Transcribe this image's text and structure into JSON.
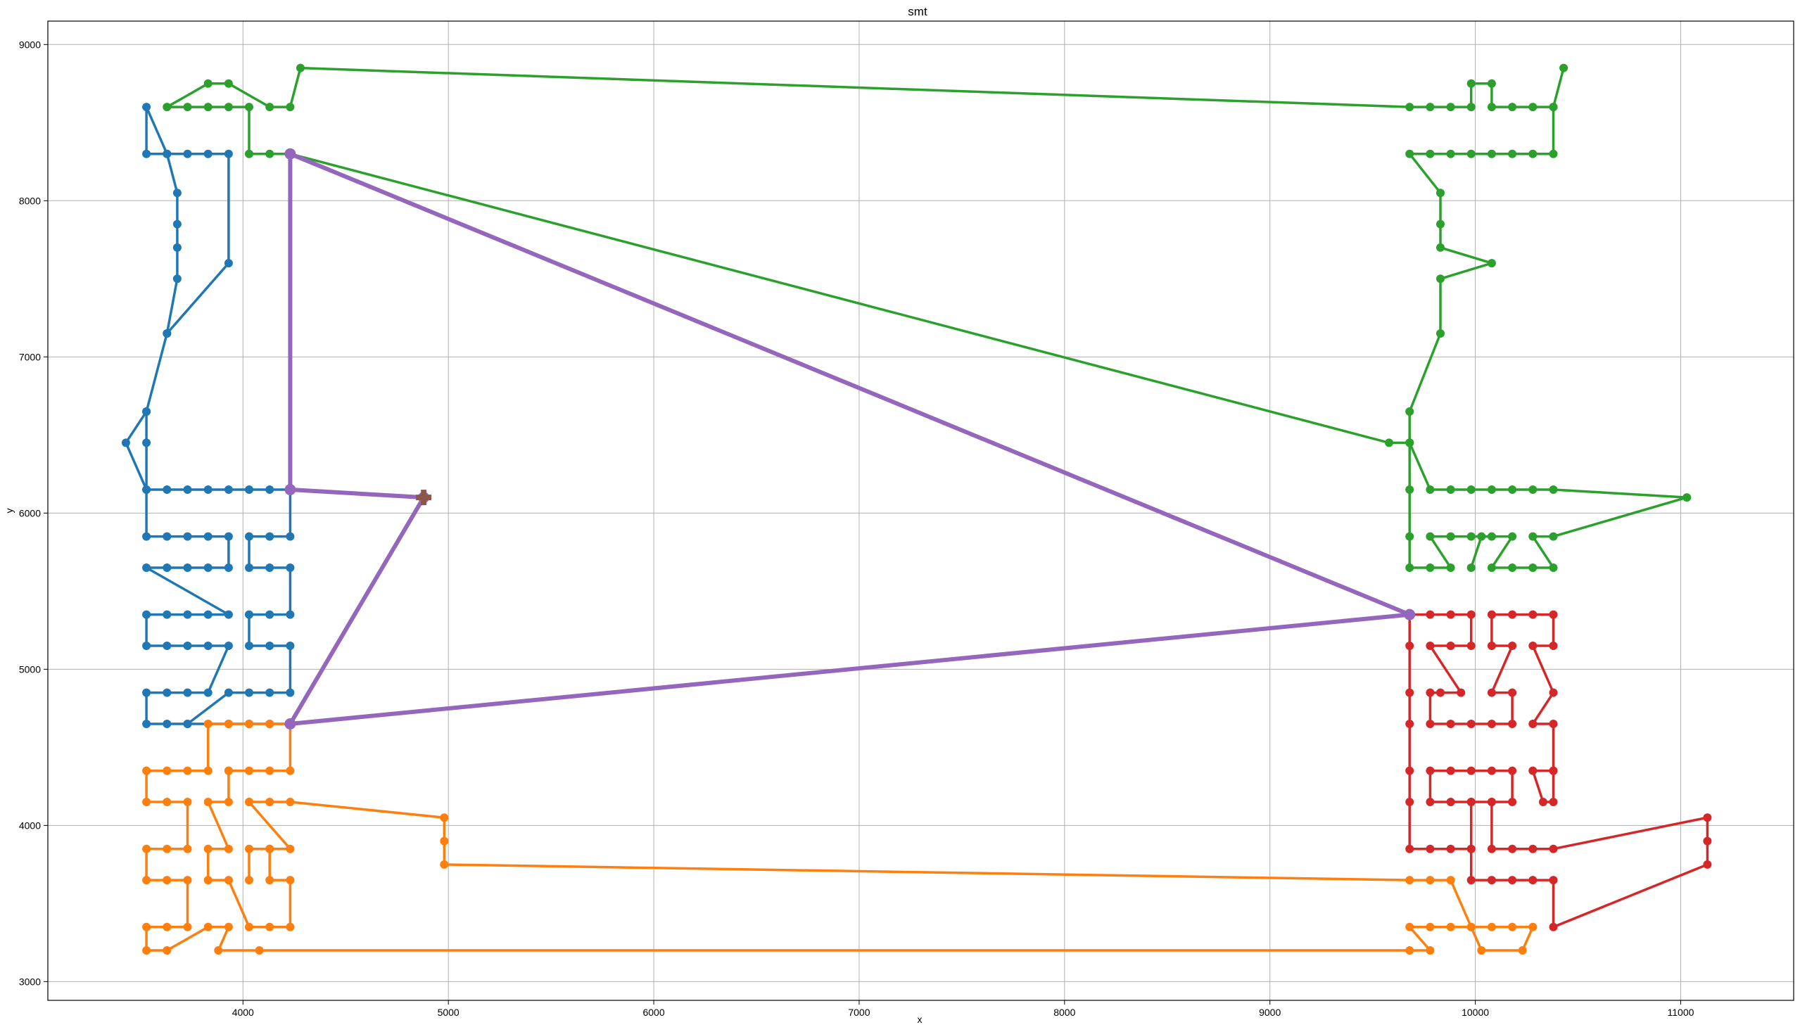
{
  "chart_data": {
    "type": "line",
    "title": "smt",
    "xlabel": "x",
    "ylabel": "y",
    "xlim": [
      3050,
      11550
    ],
    "ylim": [
      2880,
      9150
    ],
    "xticks": [
      4000,
      5000,
      6000,
      7000,
      8000,
      9000,
      10000,
      11000
    ],
    "yticks": [
      3000,
      4000,
      5000,
      6000,
      7000,
      8000,
      9000
    ],
    "grid": true,
    "colors": {
      "blue": "#1f77b4",
      "orange": "#ff7f0e",
      "green": "#2ca02c",
      "red": "#d62728",
      "purple": "#9467bd",
      "brown": "#8c564b"
    },
    "series": [
      {
        "color": "#1f77b4",
        "points": [
          [
            4230,
            4650
          ],
          [
            4130,
            4650
          ],
          [
            4030,
            4650
          ],
          [
            3930,
            4650
          ],
          [
            3730,
            4650
          ],
          [
            3630,
            4650
          ],
          [
            3530,
            4650
          ],
          [
            3530,
            4850
          ],
          [
            3630,
            4850
          ],
          [
            3730,
            4850
          ],
          [
            3830,
            4850
          ],
          [
            3930,
            5150
          ],
          [
            3830,
            5150
          ],
          [
            3730,
            5150
          ],
          [
            3630,
            5150
          ],
          [
            3530,
            5150
          ],
          [
            3530,
            5350
          ],
          [
            3630,
            5350
          ],
          [
            3730,
            5350
          ],
          [
            3830,
            5350
          ],
          [
            3930,
            5350
          ],
          [
            3530,
            5650
          ],
          [
            3630,
            5650
          ],
          [
            3730,
            5650
          ],
          [
            3830,
            5650
          ],
          [
            3930,
            5650
          ],
          [
            3930,
            5850
          ],
          [
            3830,
            5850
          ],
          [
            3730,
            5850
          ],
          [
            3630,
            5850
          ],
          [
            3530,
            5850
          ],
          [
            3530,
            6150
          ],
          [
            3530,
            6450
          ],
          [
            3530,
            6650
          ],
          [
            3430,
            6450
          ],
          [
            3530,
            6150
          ],
          [
            3630,
            6150
          ],
          [
            3730,
            6150
          ],
          [
            3830,
            6150
          ],
          [
            3930,
            6150
          ],
          [
            4030,
            6150
          ],
          [
            4130,
            6150
          ],
          [
            4230,
            6150
          ],
          [
            4230,
            5850
          ],
          [
            4130,
            5850
          ],
          [
            4030,
            5850
          ],
          [
            4030,
            5650
          ],
          [
            4130,
            5650
          ],
          [
            4230,
            5650
          ],
          [
            4230,
            5350
          ],
          [
            4130,
            5350
          ],
          [
            4030,
            5350
          ],
          [
            4030,
            5150
          ],
          [
            4130,
            5150
          ],
          [
            4230,
            5150
          ],
          [
            4230,
            4850
          ],
          [
            4130,
            4850
          ],
          [
            4030,
            4850
          ],
          [
            3930,
            4850
          ],
          [
            3730,
            4650
          ]
        ]
      },
      {
        "color": "#1f77b4",
        "points": [
          [
            3530,
            6650
          ],
          [
            3630,
            7150
          ],
          [
            3680,
            7500
          ],
          [
            3680,
            7700
          ],
          [
            3680,
            7850
          ],
          [
            3680,
            8050
          ],
          [
            3630,
            8300
          ],
          [
            3530,
            8300
          ],
          [
            3530,
            8600
          ],
          [
            3630,
            8300
          ],
          [
            3730,
            8300
          ],
          [
            3830,
            8300
          ],
          [
            3930,
            8300
          ],
          [
            3930,
            7600
          ],
          [
            3630,
            7150
          ]
        ]
      },
      {
        "color": "#ff7f0e",
        "points": [
          [
            4230,
            4650
          ],
          [
            4130,
            4650
          ],
          [
            4030,
            4650
          ],
          [
            3930,
            4650
          ],
          [
            3830,
            4650
          ],
          [
            3830,
            4350
          ],
          [
            3730,
            4350
          ],
          [
            3630,
            4350
          ],
          [
            3530,
            4350
          ],
          [
            3530,
            4150
          ],
          [
            3630,
            4150
          ],
          [
            3730,
            4150
          ],
          [
            3730,
            3850
          ],
          [
            3630,
            3850
          ],
          [
            3530,
            3850
          ],
          [
            3530,
            3650
          ],
          [
            3630,
            3650
          ],
          [
            3730,
            3650
          ],
          [
            3730,
            3350
          ],
          [
            3630,
            3350
          ],
          [
            3530,
            3350
          ],
          [
            3530,
            3200
          ],
          [
            3630,
            3200
          ],
          [
            3830,
            3350
          ],
          [
            3930,
            3350
          ],
          [
            3880,
            3200
          ],
          [
            4080,
            3200
          ],
          [
            9680,
            3200
          ],
          [
            9780,
            3200
          ],
          [
            9680,
            3350
          ],
          [
            9780,
            3350
          ],
          [
            9880,
            3350
          ],
          [
            9980,
            3350
          ],
          [
            10080,
            3350
          ],
          [
            10180,
            3350
          ],
          [
            10280,
            3350
          ],
          [
            10230,
            3200
          ],
          [
            10030,
            3200
          ],
          [
            9980,
            3350
          ]
        ]
      },
      {
        "color": "#ff7f0e",
        "points": [
          [
            3930,
            4350
          ],
          [
            4030,
            4350
          ],
          [
            4130,
            4350
          ],
          [
            4230,
            4350
          ],
          [
            4230,
            4650
          ]
        ]
      },
      {
        "color": "#ff7f0e",
        "points": [
          [
            3930,
            4350
          ],
          [
            3930,
            4150
          ],
          [
            3830,
            4150
          ],
          [
            3930,
            3850
          ],
          [
            3830,
            3850
          ],
          [
            3830,
            3650
          ],
          [
            3930,
            3650
          ],
          [
            4030,
            3350
          ],
          [
            4130,
            3350
          ],
          [
            4230,
            3350
          ],
          [
            4230,
            3650
          ],
          [
            4130,
            3650
          ],
          [
            4130,
            3850
          ],
          [
            4030,
            3850
          ],
          [
            4030,
            3650
          ]
        ]
      },
      {
        "color": "#ff7f0e",
        "points": [
          [
            4030,
            4150
          ],
          [
            4230,
            3850
          ],
          [
            4130,
            3850
          ]
        ]
      },
      {
        "color": "#ff7f0e",
        "points": [
          [
            4030,
            4150
          ],
          [
            4130,
            4150
          ],
          [
            4230,
            4150
          ],
          [
            4980,
            4050
          ],
          [
            4980,
            3900
          ],
          [
            4980,
            3750
          ],
          [
            9680,
            3650
          ],
          [
            9780,
            3650
          ],
          [
            9880,
            3650
          ],
          [
            9980,
            3350
          ]
        ]
      },
      {
        "color": "#2ca02c",
        "points": [
          [
            4230,
            8300
          ],
          [
            4130,
            8300
          ],
          [
            4030,
            8300
          ],
          [
            4030,
            8600
          ],
          [
            3930,
            8600
          ],
          [
            3830,
            8600
          ],
          [
            3730,
            8600
          ],
          [
            3630,
            8600
          ],
          [
            3830,
            8750
          ],
          [
            3930,
            8750
          ],
          [
            4130,
            8600
          ],
          [
            4230,
            8600
          ],
          [
            4280,
            8850
          ],
          [
            9680,
            8600
          ],
          [
            9780,
            8600
          ],
          [
            9880,
            8600
          ],
          [
            9980,
            8600
          ],
          [
            9980,
            8750
          ],
          [
            10080,
            8750
          ],
          [
            10080,
            8600
          ],
          [
            10180,
            8600
          ],
          [
            10280,
            8600
          ],
          [
            10380,
            8600
          ],
          [
            10430,
            8850
          ],
          [
            10380,
            8600
          ],
          [
            10380,
            8300
          ],
          [
            10280,
            8300
          ],
          [
            10180,
            8300
          ],
          [
            10080,
            8300
          ],
          [
            9980,
            8300
          ],
          [
            9880,
            8300
          ],
          [
            9780,
            8300
          ],
          [
            9680,
            8300
          ],
          [
            9830,
            8050
          ],
          [
            9830,
            7850
          ],
          [
            9830,
            7700
          ],
          [
            10080,
            7600
          ],
          [
            9830,
            7500
          ],
          [
            9830,
            7150
          ],
          [
            9680,
            6650
          ],
          [
            9680,
            6450
          ],
          [
            9580,
            6450
          ],
          [
            4230,
            8300
          ]
        ]
      },
      {
        "color": "#2ca02c",
        "points": [
          [
            9680,
            6450
          ],
          [
            9780,
            6150
          ],
          [
            9880,
            6150
          ],
          [
            9980,
            6150
          ],
          [
            10080,
            6150
          ],
          [
            10180,
            6150
          ],
          [
            10280,
            6150
          ],
          [
            10380,
            6150
          ],
          [
            11030,
            6100
          ],
          [
            10380,
            5850
          ],
          [
            10280,
            5850
          ],
          [
            10380,
            5650
          ],
          [
            10280,
            5650
          ],
          [
            10180,
            5650
          ],
          [
            10080,
            5650
          ],
          [
            10180,
            5850
          ],
          [
            10080,
            5850
          ],
          [
            9980,
            5850
          ],
          [
            9880,
            5850
          ],
          [
            9780,
            5850
          ],
          [
            9880,
            5650
          ],
          [
            9780,
            5650
          ],
          [
            9680,
            5650
          ],
          [
            9680,
            5850
          ],
          [
            9680,
            6150
          ],
          [
            9680,
            6450
          ]
        ]
      },
      {
        "color": "#2ca02c",
        "points": [
          [
            9980,
            5650
          ],
          [
            10030,
            5850
          ]
        ]
      },
      {
        "color": "#d62728",
        "points": [
          [
            9680,
            5350
          ],
          [
            9780,
            5350
          ],
          [
            9880,
            5350
          ],
          [
            9980,
            5350
          ],
          [
            9980,
            5150
          ],
          [
            9880,
            5150
          ],
          [
            9780,
            5150
          ],
          [
            9930,
            4850
          ],
          [
            9830,
            4850
          ],
          [
            9780,
            4850
          ],
          [
            9780,
            4650
          ],
          [
            9880,
            4650
          ],
          [
            9980,
            4650
          ],
          [
            10080,
            4650
          ],
          [
            10180,
            4650
          ],
          [
            10180,
            4850
          ],
          [
            10080,
            4850
          ],
          [
            10180,
            5150
          ],
          [
            10080,
            5150
          ],
          [
            10080,
            5350
          ],
          [
            10180,
            5350
          ],
          [
            10280,
            5350
          ],
          [
            10380,
            5350
          ],
          [
            10380,
            5150
          ],
          [
            10280,
            5150
          ],
          [
            10380,
            4850
          ],
          [
            10280,
            4650
          ],
          [
            10380,
            4650
          ],
          [
            10380,
            4350
          ],
          [
            10280,
            4350
          ],
          [
            10330,
            4150
          ],
          [
            10380,
            4150
          ],
          [
            10380,
            4350
          ]
        ]
      },
      {
        "color": "#d62728",
        "points": [
          [
            9680,
            5350
          ],
          [
            9680,
            5150
          ],
          [
            9680,
            4850
          ],
          [
            9680,
            4650
          ],
          [
            9680,
            4350
          ],
          [
            9680,
            4150
          ],
          [
            9680,
            3850
          ],
          [
            9780,
            3850
          ],
          [
            9880,
            3850
          ],
          [
            9980,
            3850
          ],
          [
            9980,
            4150
          ],
          [
            9880,
            4150
          ],
          [
            9780,
            4150
          ],
          [
            9780,
            4350
          ],
          [
            9880,
            4350
          ],
          [
            9980,
            4350
          ],
          [
            10080,
            4350
          ],
          [
            10180,
            4350
          ],
          [
            10180,
            4150
          ],
          [
            10080,
            4150
          ],
          [
            10080,
            3850
          ],
          [
            10180,
            3850
          ],
          [
            10280,
            3850
          ],
          [
            10380,
            3850
          ],
          [
            11130,
            4050
          ],
          [
            11130,
            3900
          ],
          [
            11130,
            3750
          ],
          [
            10380,
            3350
          ],
          [
            10380,
            3650
          ],
          [
            10280,
            3650
          ],
          [
            10180,
            3650
          ],
          [
            10080,
            3650
          ],
          [
            9980,
            3650
          ],
          [
            9980,
            3850
          ]
        ]
      },
      {
        "color": "#d62728",
        "points": [
          [
            9980,
            4150
          ],
          [
            10080,
            4150
          ]
        ]
      },
      {
        "color": "#9467bd",
        "emphasis": true,
        "points": [
          [
            4880,
            6100
          ],
          [
            4230,
            6150
          ],
          [
            4230,
            8300
          ],
          [
            9680,
            5350
          ],
          [
            4230,
            4650
          ],
          [
            4880,
            6100
          ]
        ]
      }
    ],
    "special_marker": {
      "shape": "plus",
      "color": "#8c564b",
      "point": [
        4880,
        6100
      ]
    }
  }
}
